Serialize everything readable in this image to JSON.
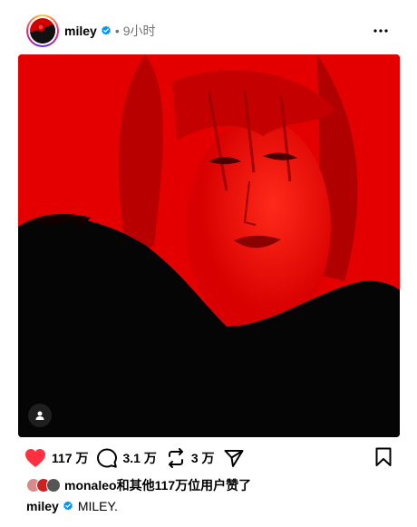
{
  "post": {
    "username": "miley",
    "separator": "•",
    "time": "9小时",
    "icons": {
      "more": "more-horizontal-icon",
      "verified": "verified-badge-icon",
      "user_tag": "user-tag-icon"
    }
  },
  "actions": {
    "like_count": "117 万",
    "comment_count": "3.1 万",
    "repost_count": "3 万",
    "colors": {
      "liked": "#ff3040"
    },
    "icons": [
      "heart-icon",
      "comment-icon",
      "repost-icon",
      "share-icon",
      "bookmark-icon"
    ]
  },
  "likes_summary": {
    "text": "monaleo和其他117万位用户赞了"
  },
  "caption": {
    "username": "miley",
    "text": "MILEY."
  },
  "colors": {
    "verified": "#0095f6",
    "muted": "#737373",
    "media_red": "#e10000"
  }
}
